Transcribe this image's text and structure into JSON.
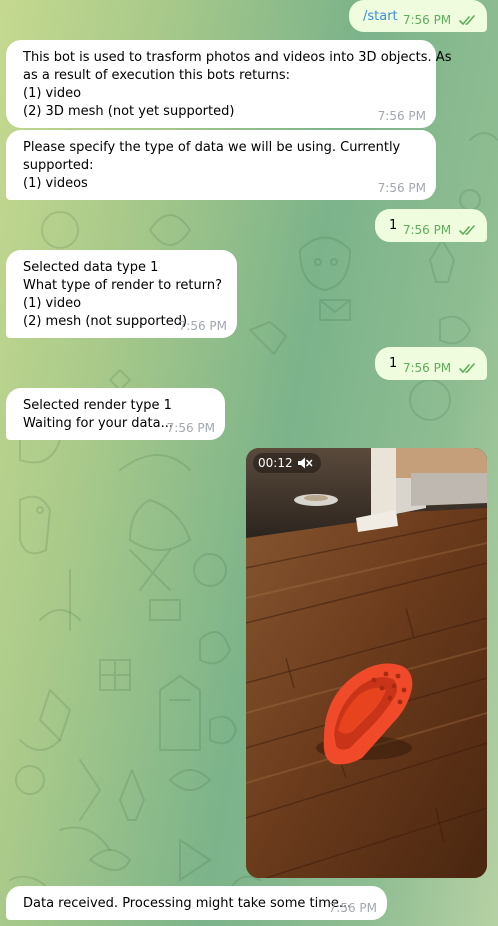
{
  "messages": [
    {
      "id": "m1",
      "direction": "out",
      "lines": [
        "/start"
      ],
      "time": "7:56 PM",
      "read": true
    },
    {
      "id": "m2",
      "direction": "in",
      "lines": [
        "This bot is used to trasform photos and videos into 3D objects. As",
        "as a result of execution this bots returns:",
        "(1) video",
        "(2) 3D mesh (not yet supported)"
      ],
      "time": "7:56 PM"
    },
    {
      "id": "m3",
      "direction": "in",
      "lines": [
        "Please specify the type of data we will be using. Currently",
        "supported:",
        "(1) videos"
      ],
      "time": "7:56 PM"
    },
    {
      "id": "m4",
      "direction": "out",
      "lines": [
        "1"
      ],
      "time": "7:56 PM",
      "read": true
    },
    {
      "id": "m5",
      "direction": "in",
      "lines": [
        "Selected data type 1",
        "What type of render to return?",
        "(1) video",
        "(2) mesh (not supported)"
      ],
      "time": "7:56 PM"
    },
    {
      "id": "m6",
      "direction": "out",
      "lines": [
        "1"
      ],
      "time": "7:56 PM",
      "read": true
    },
    {
      "id": "m7",
      "direction": "in",
      "lines": [
        "Selected render type 1",
        "Waiting for your data..."
      ],
      "time": "7:56 PM"
    },
    {
      "id": "m9",
      "direction": "in",
      "lines": [
        "Data received. Processing might take some time..."
      ],
      "time": "7:56 PM"
    }
  ],
  "video": {
    "duration": "00:12",
    "muted_icon": "speaker-muted-icon"
  },
  "icons": {
    "read_ticks": "double-check-icon"
  },
  "colors": {
    "incoming_bubble": "#ffffff",
    "outgoing_bubble": "#effdde",
    "outgoing_meta": "#5fae5a",
    "incoming_meta": "#a0a8b0",
    "command_link": "#3a8fd6"
  }
}
